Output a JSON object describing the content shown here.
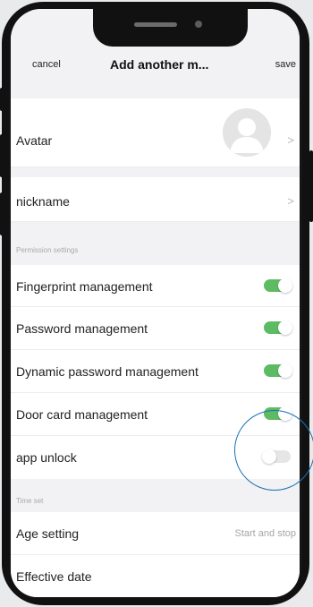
{
  "nav": {
    "cancel_label": "cancel",
    "title": "Add another m...",
    "save_label": "save"
  },
  "profile": {
    "avatar_label": "Avatar",
    "nickname_label": "nickname",
    "chevron": ">"
  },
  "permissions": {
    "section_label": "Permission settings",
    "items": [
      {
        "label": "Fingerprint management",
        "enabled": true
      },
      {
        "label": "Password management",
        "enabled": true
      },
      {
        "label": "Dynamic password management",
        "enabled": true
      },
      {
        "label": "Door card management",
        "enabled": true
      },
      {
        "label": "app unlock",
        "enabled": false
      }
    ]
  },
  "time": {
    "section_label": "Time set",
    "age_setting_label": "Age setting",
    "age_setting_value": "Start and stop",
    "effective_date_label": "Effective date"
  },
  "colors": {
    "toggle_on": "#5dbb63",
    "toggle_off": "#e6e6e6",
    "highlight": "#1a73b5"
  },
  "icons": {
    "avatar": "person-silhouette-icon",
    "chevron": "chevron-right-icon"
  }
}
